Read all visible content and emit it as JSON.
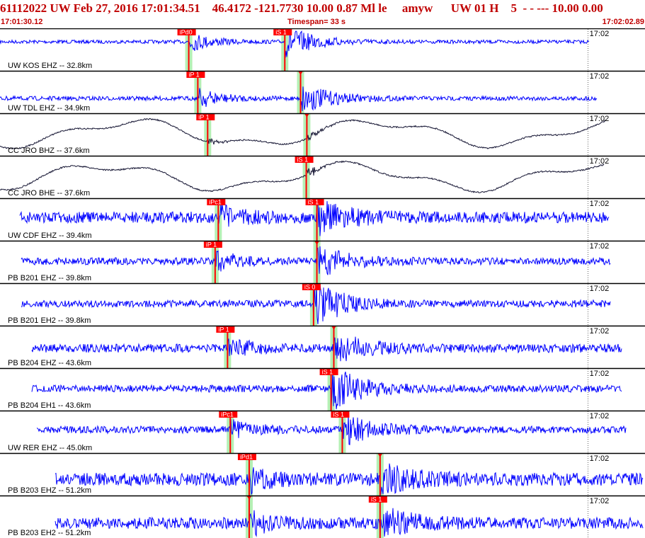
{
  "header": {
    "event_id": "61112022",
    "network": "UW",
    "date": "Feb 27, 2016",
    "time": "17:01:34.51",
    "lat": "46.4172",
    "lon": "-121.7730",
    "depth": "10.00",
    "magnitude": "0.87",
    "mag_type": "Ml",
    "flags": "le",
    "author": "amyw",
    "network2": "UW",
    "version": "01",
    "type": "H",
    "count": "5",
    "dashes": "- - ---",
    "extra1": "10.00",
    "extra2": "0.00",
    "start_time": "17:01:30.12",
    "timespan_label": "Timespan=  33 s",
    "end_time": "17:02:02.89"
  },
  "colors": {
    "header_red": "#c00000",
    "trace_blue": "#0000ff",
    "trace_dark": "#141432",
    "pick_red": "#ff0000",
    "pick_green": "#b4f0b4",
    "divider": "#000000"
  },
  "time_axis": {
    "start_s": 0,
    "end_s": 32.77,
    "tick_label": "17:02",
    "tick_time_s": 29.88
  },
  "channels": [
    {
      "label": "UW KOS EHZ -- 32.8km",
      "trace_color": "blue",
      "amplitude": "small",
      "picks": [
        {
          "phase": "iPd0",
          "time_s": 9.59
        },
        {
          "phase": "iS 1",
          "time_s": 14.47
        }
      ]
    },
    {
      "label": "UW TDL EHZ -- 34.9km",
      "trace_color": "blue",
      "amplitude": "small",
      "picks": [
        {
          "phase": "iP 1",
          "time_s": 10.05
        },
        {
          "phase": "",
          "time_s": 15.27
        }
      ]
    },
    {
      "label": "CC JRO BHZ -- 37.6km",
      "trace_color": "dark",
      "amplitude": "long-period",
      "picks": [
        {
          "phase": "iP 1",
          "time_s": 10.55
        },
        {
          "phase": "",
          "time_s": 15.59
        }
      ]
    },
    {
      "label": "CC JRO BHE -- 37.6km",
      "trace_color": "dark",
      "amplitude": "long-period",
      "picks": [
        {
          "phase": "iS 1",
          "time_s": 15.56
        }
      ]
    },
    {
      "label": "UW CDF EHZ -- 39.4km",
      "trace_color": "blue",
      "amplitude": "large",
      "picks": [
        {
          "phase": "iPc1",
          "time_s": 11.09
        },
        {
          "phase": "iS 1",
          "time_s": 16.1
        }
      ]
    },
    {
      "label": "PB B201 EHZ -- 39.8km",
      "trace_color": "blue",
      "amplitude": "medium",
      "picks": [
        {
          "phase": "iP 1",
          "time_s": 10.93
        },
        {
          "phase": "",
          "time_s": 16.1
        }
      ]
    },
    {
      "label": "PB B201 EH2 -- 39.8km",
      "trace_color": "blue",
      "amplitude": "medium",
      "picks": [
        {
          "phase": "iS 0",
          "time_s": 15.93
        }
      ]
    },
    {
      "label": "PB B204 EHZ -- 43.6km",
      "trace_color": "blue",
      "amplitude": "medium",
      "picks": [
        {
          "phase": "iP 1",
          "time_s": 11.56
        },
        {
          "phase": "",
          "time_s": 16.96
        }
      ]
    },
    {
      "label": "PB B204 EH1 -- 43.6km",
      "trace_color": "blue",
      "amplitude": "medium",
      "picks": [
        {
          "phase": "iS 1",
          "time_s": 16.82
        }
      ]
    },
    {
      "label": "UW RER EHZ -- 45.0km",
      "trace_color": "blue",
      "amplitude": "medium",
      "picks": [
        {
          "phase": "iPc1",
          "time_s": 11.7
        },
        {
          "phase": "iS 1",
          "time_s": 17.39
        }
      ]
    },
    {
      "label": "PB B203 EHZ -- 51.2km",
      "trace_color": "blue",
      "amplitude": "large",
      "picks": [
        {
          "phase": "iPd1",
          "time_s": 12.66
        },
        {
          "phase": "",
          "time_s": 19.31
        }
      ]
    },
    {
      "label": "PB B203 EH2 -- 51.2km",
      "trace_color": "blue",
      "amplitude": "large",
      "picks": [
        {
          "phase": "",
          "time_s": 12.66
        },
        {
          "phase": "iS 1",
          "time_s": 19.31
        }
      ]
    }
  ]
}
